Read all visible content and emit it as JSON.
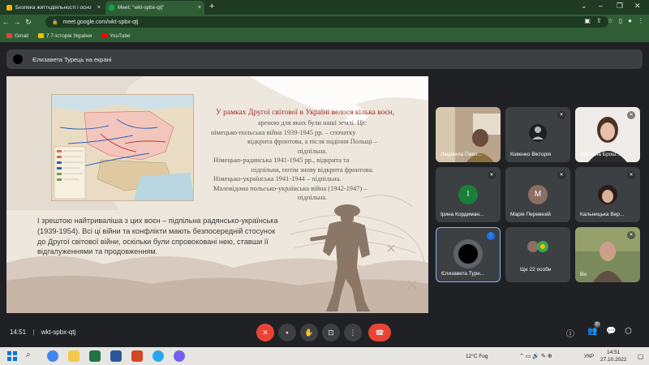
{
  "browser": {
    "tabs": [
      {
        "title": "Безпека життєдіяльності і осно",
        "close": "×"
      },
      {
        "title": "Meet: \"wkt-spbx-qtj\"",
        "close": "×"
      }
    ],
    "new_tab": "+",
    "url": "meet.google.com/wkt-spbx-qtj",
    "bookmarks": [
      "Gmail",
      "7.7-Історія України",
      "YouTube"
    ],
    "window_controls": [
      "⌄",
      "–",
      "❐",
      "✕"
    ]
  },
  "meet": {
    "presenting_banner": "Єлизавета Турець на екрані",
    "time": "14:51",
    "separator": "|",
    "meeting_code": "wkt-spbx-qtj",
    "participants_badge": "30"
  },
  "slide": {
    "title_red": "У рамках Другої світової в Україні велося кілька воєн,",
    "lines": [
      "ареною для яких були наші землі. Це:",
      "німецько-польська війна 1939-1945 рр. – спочатку",
      "відкрита фронтова, а після падіння Польщі –",
      "підпільна.",
      "Німецько-радянська 1941-1945 рр., відкрита та",
      "підпільна, потім знову відкрита фронтова.",
      "Німецько-українська 1941-1944 – підпільна.",
      "Маловідома польсько-українська війна (1942-1947) –",
      "підпільна."
    ],
    "body": "І зрештою найтриваліша з цих воєн – підпільна радянсько-українська (1939-1954). Всі ці війни та конфлікти мають безпосередній стосунок до Другої світової війни, оскільки були спровоковані нею, ставши її відгалуженнями та продовженням."
  },
  "participants": [
    {
      "name": "Людмила Павл...",
      "letter": ""
    },
    {
      "name": "Ковенко Вікторія",
      "letter": ""
    },
    {
      "name": "Ангеліна Брош...",
      "letter": ""
    },
    {
      "name": "Ірина Кордиман...",
      "letter": "І"
    },
    {
      "name": "Марія Перевезій",
      "letter": "М"
    },
    {
      "name": "Кальницька Вер...",
      "letter": ""
    },
    {
      "name": "Єлизавета Туре...",
      "letter": ""
    },
    {
      "name": "Ще 22 особи",
      "letter": ""
    },
    {
      "name": "Ви",
      "letter": ""
    }
  ],
  "taskbar": {
    "weather": "12°C  Fog",
    "lang": "УКР",
    "time": "14:51",
    "date": "27.10.2022"
  },
  "colors": {
    "meet_bg": "#202124",
    "tile_bg": "#3c4043",
    "end_call": "#ea4335",
    "chrome_green": "#2f5e35",
    "slide_bg": "#eee7dd",
    "slide_red": "#9a2a2a"
  }
}
